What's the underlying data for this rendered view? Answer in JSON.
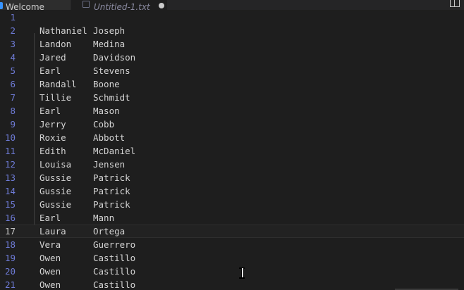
{
  "tabs": [
    {
      "label": "Welcome",
      "active": false
    },
    {
      "label": "Untitled-1.txt",
      "active": true,
      "dirty": true
    }
  ],
  "editor": {
    "current_line": 17,
    "lines": [
      {
        "number": "1",
        "first": "",
        "last": ""
      },
      {
        "number": "2",
        "first": "Nathaniel",
        "last": "Joseph"
      },
      {
        "number": "3",
        "first": "Landon",
        "last": "Medina"
      },
      {
        "number": "4",
        "first": "Jared",
        "last": "Davidson"
      },
      {
        "number": "5",
        "first": "Earl",
        "last": "Stevens"
      },
      {
        "number": "6",
        "first": "Randall",
        "last": "Boone"
      },
      {
        "number": "7",
        "first": "Tillie",
        "last": "Schmidt"
      },
      {
        "number": "8",
        "first": "Earl",
        "last": "Mason"
      },
      {
        "number": "9",
        "first": "Jerry",
        "last": "Cobb"
      },
      {
        "number": "10",
        "first": "Roxie",
        "last": "Abbott"
      },
      {
        "number": "11",
        "first": "Edith",
        "last": "McDaniel"
      },
      {
        "number": "12",
        "first": "Louisa",
        "last": "Jensen"
      },
      {
        "number": "13",
        "first": "Gussie",
        "last": "Patrick"
      },
      {
        "number": "14",
        "first": "Gussie",
        "last": "Patrick"
      },
      {
        "number": "15",
        "first": "Gussie",
        "last": "Patrick"
      },
      {
        "number": "16",
        "first": "Earl",
        "last": "Mann"
      },
      {
        "number": "17",
        "first": "Laura",
        "last": "Ortega"
      },
      {
        "number": "18",
        "first": "Vera",
        "last": "Guerrero"
      },
      {
        "number": "19",
        "first": "Owen",
        "last": "Castillo"
      },
      {
        "number": "20",
        "first": "Owen",
        "last": "Castillo"
      },
      {
        "number": "21",
        "first": "Owen",
        "last": "Castillo"
      }
    ]
  },
  "colors": {
    "background": "#1e1e1e",
    "line_number": "#6e7bd6",
    "text": "#d4d4d4"
  },
  "icons": {
    "welcome_tab": "vscode-logo-icon",
    "untitled_tab": "file-icon",
    "dirty": "unsaved-dot-icon",
    "split": "split-editor-icon",
    "pointer": "text-cursor-icon"
  }
}
